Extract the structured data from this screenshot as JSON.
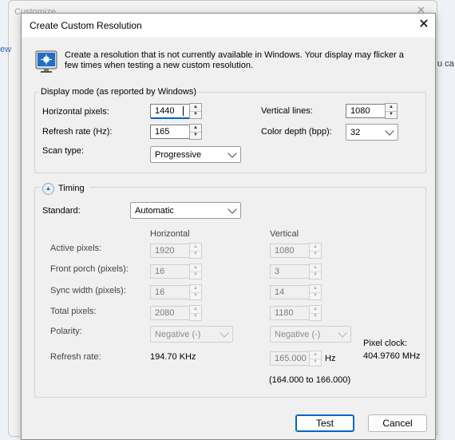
{
  "background": {
    "window_title": "Customize",
    "close_label": "✕",
    "left_fragment": "ew",
    "right_fragment": "u ca"
  },
  "dialog": {
    "title": "Create Custom Resolution",
    "close_label": "✕",
    "intro": "Create a resolution that is not currently available in Windows. Your display may flicker a few times when testing a new custom resolution."
  },
  "display_mode": {
    "legend": "Display mode (as reported by Windows)",
    "horizontal_pixels": {
      "label": "Horizontal pixels:",
      "value": "1440"
    },
    "vertical_lines": {
      "label": "Vertical lines:",
      "value": "1080"
    },
    "refresh_rate": {
      "label": "Refresh rate (Hz):",
      "value": "165"
    },
    "color_depth": {
      "label": "Color depth (bpp):",
      "value": "32"
    },
    "scan_type": {
      "label": "Scan type:",
      "value": "Progressive"
    }
  },
  "timing": {
    "legend": "Timing",
    "toggle_icon": "▲",
    "standard": {
      "label": "Standard:",
      "value": "Automatic"
    },
    "col_horizontal": "Horizontal",
    "col_vertical": "Vertical",
    "rows": [
      {
        "label": "Active pixels:",
        "h": "1920",
        "v": "1080"
      },
      {
        "label": "Front porch (pixels):",
        "h": "16",
        "v": "3"
      },
      {
        "label": "Sync width (pixels):",
        "h": "16",
        "v": "14"
      },
      {
        "label": "Total pixels:",
        "h": "2080",
        "v": "1180"
      }
    ],
    "polarity": {
      "label": "Polarity:",
      "h": "Negative (-)",
      "v": "Negative (-)"
    },
    "refresh": {
      "label": "Refresh rate:",
      "h": "194.70 KHz",
      "v": "165.000",
      "unit": "Hz",
      "range": "(164.000 to 166.000)"
    },
    "pixel_clock": {
      "label": "Pixel clock:",
      "value": "404.9760 MHz"
    }
  },
  "buttons": {
    "test": "Test",
    "cancel": "Cancel"
  },
  "icons": {
    "monitor": "monitor-icon",
    "spin_up": "▲",
    "spin_down": "▼"
  },
  "colors": {
    "accent": "#0067c0",
    "dialog_bg": "#f0f0f0"
  }
}
